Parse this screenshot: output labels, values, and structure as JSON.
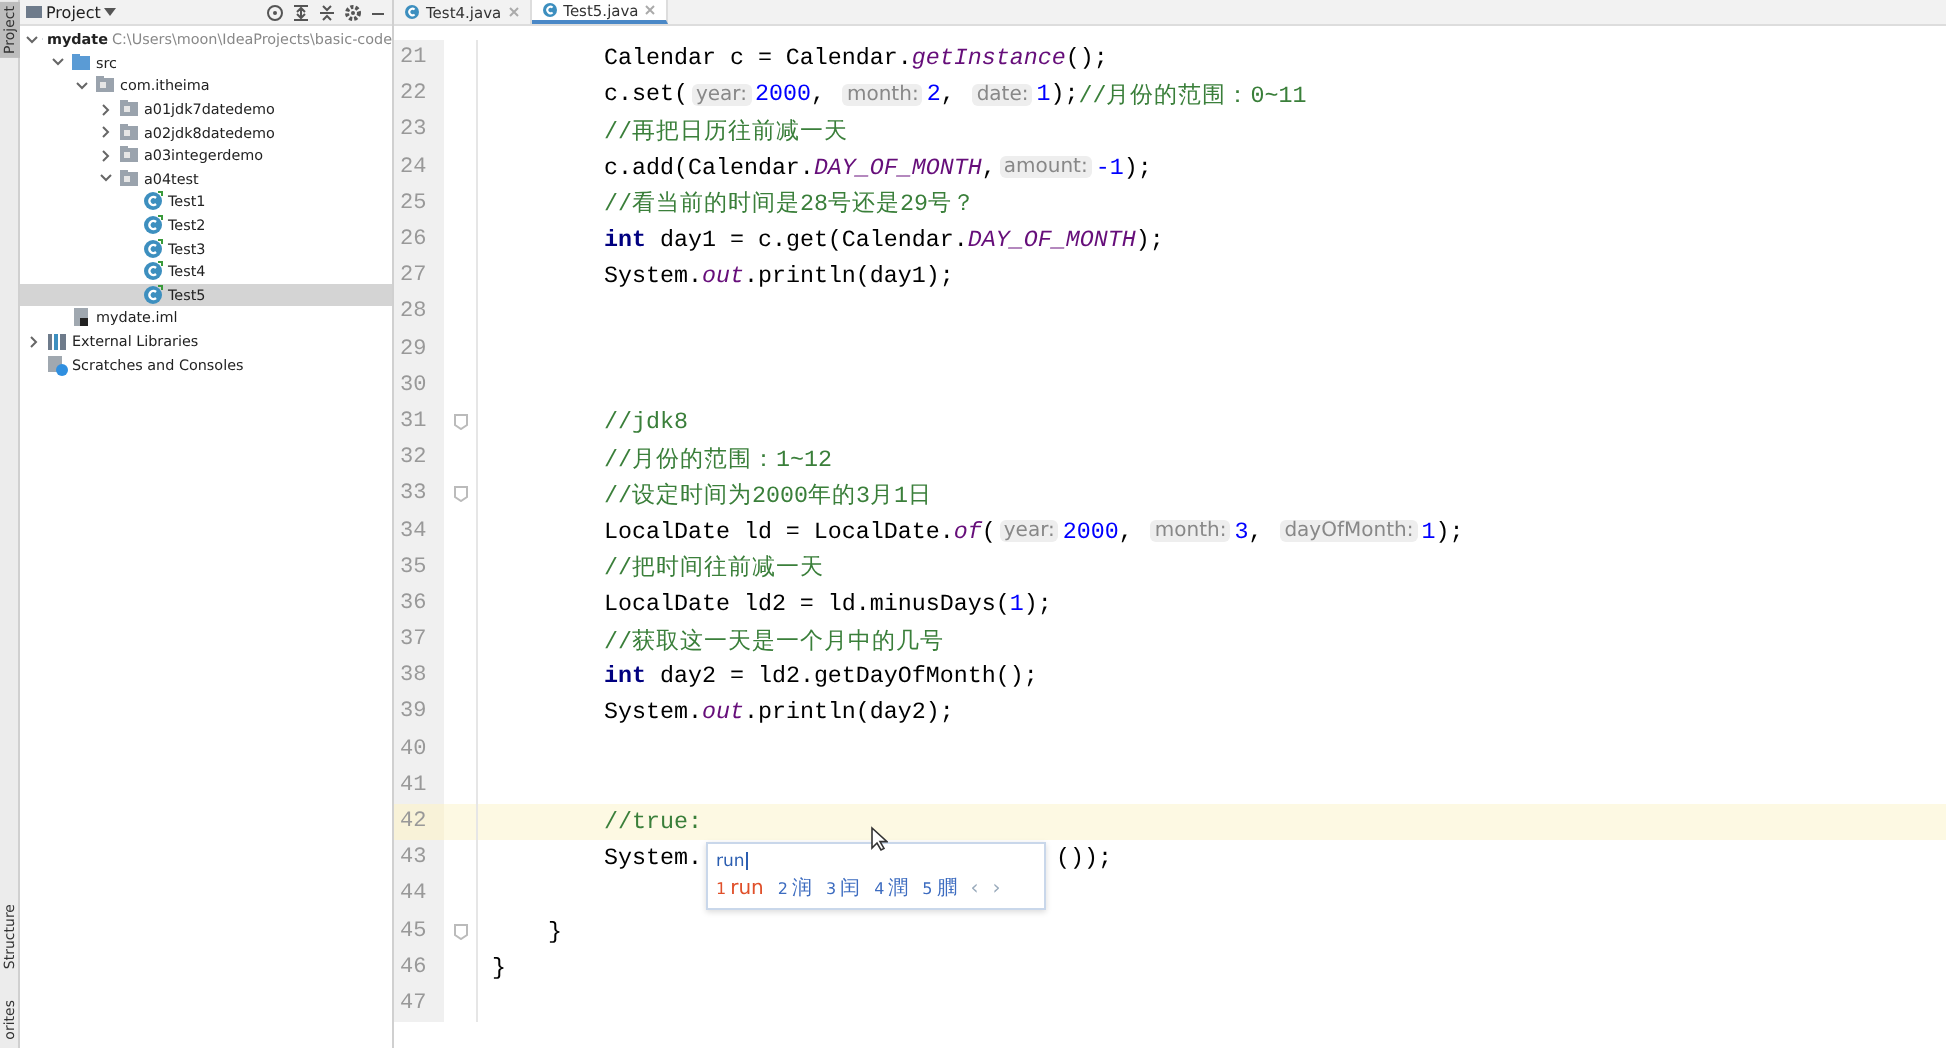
{
  "side_strip": [
    {
      "label": "Project",
      "selected": true
    },
    {
      "label": "Structure",
      "selected": false
    },
    {
      "label": "orites",
      "selected": false
    }
  ],
  "project_panel": {
    "title": "Project",
    "tree": [
      {
        "label": "mydate",
        "path": "C:\\Users\\moon\\IdeaProjects\\basic-code",
        "kind": "module",
        "expanded": true,
        "selected": false,
        "children": [
          {
            "label": "src",
            "kind": "source",
            "expanded": true,
            "selected": false,
            "children": [
              {
                "label": "com.itheima",
                "kind": "package",
                "expanded": true,
                "selected": false,
                "children": [
                  {
                    "label": "a01jdk7datedemo",
                    "kind": "package",
                    "expanded": false,
                    "selected": false
                  },
                  {
                    "label": "a02jdk8datedemo",
                    "kind": "package",
                    "expanded": false,
                    "selected": false
                  },
                  {
                    "label": "a03integerdemo",
                    "kind": "package",
                    "expanded": false,
                    "selected": false
                  },
                  {
                    "label": "a04test",
                    "kind": "package",
                    "expanded": true,
                    "selected": false,
                    "children": [
                      {
                        "label": "Test1",
                        "kind": "class",
                        "selected": false
                      },
                      {
                        "label": "Test2",
                        "kind": "class",
                        "selected": false
                      },
                      {
                        "label": "Test3",
                        "kind": "class",
                        "selected": false
                      },
                      {
                        "label": "Test4",
                        "kind": "class",
                        "selected": false
                      },
                      {
                        "label": "Test5",
                        "kind": "class",
                        "selected": true
                      }
                    ]
                  }
                ]
              }
            ]
          },
          {
            "label": "mydate.iml",
            "kind": "iml",
            "selected": false
          }
        ]
      },
      {
        "label": "External Libraries",
        "kind": "library",
        "expanded": false,
        "selected": false
      },
      {
        "label": "Scratches and Consoles",
        "kind": "scratch",
        "selected": false
      }
    ]
  },
  "tabs": [
    {
      "label": "Test4.java",
      "selected": false
    },
    {
      "label": "Test5.java",
      "selected": true
    }
  ],
  "code_lines": [
    {
      "number": "21",
      "kind": "statement",
      "fold": false,
      "current": false,
      "tokens": [
        {
          "kind": "plain",
          "text": "Calendar c = Calendar."
        },
        {
          "kind": "static",
          "text": "getInstance"
        },
        {
          "kind": "plain",
          "text": "();"
        }
      ]
    },
    {
      "number": "22",
      "kind": "statement",
      "fold": false,
      "current": false,
      "tokens": [
        {
          "kind": "plain",
          "text": "c.set("
        },
        {
          "kind": "hint",
          "text": "year:"
        },
        {
          "kind": "number",
          "text": "2000"
        },
        {
          "kind": "plain",
          "text": ", "
        },
        {
          "kind": "hint",
          "text": "month:"
        },
        {
          "kind": "number",
          "text": "2"
        },
        {
          "kind": "plain",
          "text": ", "
        },
        {
          "kind": "hint",
          "text": "date:"
        },
        {
          "kind": "number",
          "text": "1"
        },
        {
          "kind": "plain",
          "text": ");"
        },
        {
          "kind": "comment",
          "text": "//月份的范围：0~11"
        }
      ]
    },
    {
      "number": "23",
      "kind": "statement",
      "fold": false,
      "current": false,
      "tokens": [
        {
          "kind": "comment",
          "text": "//再把日历往前减一天"
        }
      ]
    },
    {
      "number": "24",
      "kind": "statement",
      "fold": false,
      "current": false,
      "tokens": [
        {
          "kind": "plain",
          "text": "c.add(Calendar."
        },
        {
          "kind": "static",
          "text": "DAY_OF_MONTH"
        },
        {
          "kind": "plain",
          "text": ","
        },
        {
          "kind": "hint",
          "text": "amount:"
        },
        {
          "kind": "number",
          "text": "-1"
        },
        {
          "kind": "plain",
          "text": ");"
        }
      ]
    },
    {
      "number": "25",
      "kind": "statement",
      "fold": false,
      "current": false,
      "tokens": [
        {
          "kind": "comment",
          "text": "//看当前的时间是28号还是29号？"
        }
      ]
    },
    {
      "number": "26",
      "kind": "statement",
      "fold": false,
      "current": false,
      "tokens": [
        {
          "kind": "keyword",
          "text": "int"
        },
        {
          "kind": "plain",
          "text": " day1 = c.get(Calendar."
        },
        {
          "kind": "static",
          "text": "DAY_OF_MONTH"
        },
        {
          "kind": "plain",
          "text": ");"
        }
      ]
    },
    {
      "number": "27",
      "kind": "statement",
      "fold": false,
      "current": false,
      "tokens": [
        {
          "kind": "plain",
          "text": "System."
        },
        {
          "kind": "static",
          "text": "out"
        },
        {
          "kind": "plain",
          "text": ".println(day1);"
        }
      ]
    },
    {
      "number": "28",
      "fold": false,
      "current": false
    },
    {
      "number": "29",
      "fold": false,
      "current": false
    },
    {
      "number": "30",
      "fold": false,
      "current": false
    },
    {
      "number": "31",
      "kind": "statement",
      "fold": true,
      "current": false,
      "tokens": [
        {
          "kind": "comment",
          "text": "//jdk8"
        }
      ]
    },
    {
      "number": "32",
      "kind": "statement",
      "fold": false,
      "current": false,
      "tokens": [
        {
          "kind": "comment",
          "text": "//月份的范围：1~12"
        }
      ]
    },
    {
      "number": "33",
      "kind": "statement",
      "fold": true,
      "current": false,
      "tokens": [
        {
          "kind": "comment",
          "text": "//设定时间为2000年的3月1日"
        }
      ]
    },
    {
      "number": "34",
      "kind": "statement",
      "fold": false,
      "current": false,
      "tokens": [
        {
          "kind": "plain",
          "text": "LocalDate ld = LocalDate."
        },
        {
          "kind": "static",
          "text": "of"
        },
        {
          "kind": "plain",
          "text": "("
        },
        {
          "kind": "hint",
          "text": "year:"
        },
        {
          "kind": "number",
          "text": "2000"
        },
        {
          "kind": "plain",
          "text": ", "
        },
        {
          "kind": "hint",
          "text": "month:"
        },
        {
          "kind": "number",
          "text": "3"
        },
        {
          "kind": "plain",
          "text": ", "
        },
        {
          "kind": "hint",
          "text": "dayOfMonth:"
        },
        {
          "kind": "number",
          "text": "1"
        },
        {
          "kind": "plain",
          "text": ");"
        }
      ]
    },
    {
      "number": "35",
      "kind": "statement",
      "fold": false,
      "current": false,
      "tokens": [
        {
          "kind": "comment",
          "text": "//把时间往前减一天"
        }
      ]
    },
    {
      "number": "36",
      "kind": "statement",
      "fold": false,
      "current": false,
      "tokens": [
        {
          "kind": "plain",
          "text": "LocalDate ld2 = ld.minusDays("
        },
        {
          "kind": "number",
          "text": "1"
        },
        {
          "kind": "plain",
          "text": ");"
        }
      ]
    },
    {
      "number": "37",
      "kind": "statement",
      "fold": false,
      "current": false,
      "tokens": [
        {
          "kind": "comment",
          "text": "//获取这一天是一个月中的几号"
        }
      ]
    },
    {
      "number": "38",
      "kind": "statement",
      "fold": false,
      "current": false,
      "tokens": [
        {
          "kind": "keyword",
          "text": "int"
        },
        {
          "kind": "plain",
          "text": " day2 = ld2.getDayOfMonth();"
        }
      ]
    },
    {
      "number": "39",
      "kind": "statement",
      "fold": false,
      "current": false,
      "tokens": [
        {
          "kind": "plain",
          "text": "System."
        },
        {
          "kind": "static",
          "text": "out"
        },
        {
          "kind": "plain",
          "text": ".println(day2);"
        }
      ]
    },
    {
      "number": "40",
      "fold": false,
      "current": false
    },
    {
      "number": "41",
      "fold": false,
      "current": false
    },
    {
      "number": "42",
      "kind": "statement",
      "fold": false,
      "current": true,
      "tokens": [
        {
          "kind": "comment",
          "text": "//true:"
        }
      ]
    },
    {
      "number": "43",
      "kind": "statement",
      "fold": false,
      "current": false,
      "tokens": [
        {
          "kind": "plain",
          "text": "System."
        },
        {
          "kind": "after_popup",
          "text": "());"
        }
      ]
    },
    {
      "number": "44",
      "fold": false,
      "current": false
    },
    {
      "number": "45",
      "kind": "method_end",
      "fold": true,
      "current": false,
      "tokens": [
        {
          "kind": "plain",
          "text": "}"
        }
      ]
    },
    {
      "number": "46",
      "kind": "class_end",
      "fold": false,
      "current": false,
      "tokens": [
        {
          "kind": "plain",
          "text": "}"
        }
      ]
    },
    {
      "number": "47",
      "fold": false,
      "current": false
    }
  ],
  "ime_popup": {
    "input": "run",
    "candidates": [
      {
        "index": "1",
        "text": "run",
        "selected": true
      },
      {
        "index": "2",
        "text": "润",
        "selected": false
      },
      {
        "index": "3",
        "text": "闰",
        "selected": false
      },
      {
        "index": "4",
        "text": "潤",
        "selected": false
      },
      {
        "index": "5",
        "text": "膶",
        "selected": false
      }
    ],
    "prev": "‹",
    "next": "›"
  }
}
